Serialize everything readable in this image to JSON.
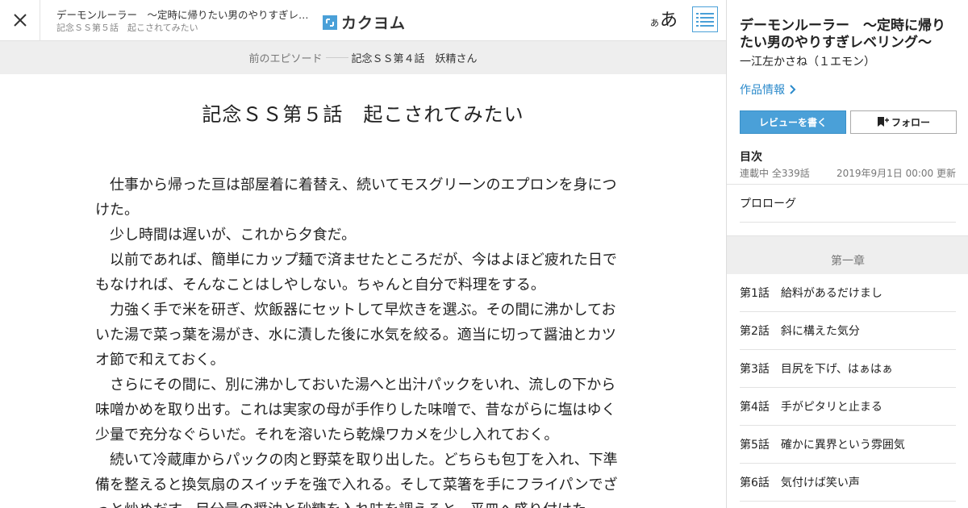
{
  "header": {
    "work_title": "デーモンルーラー　～定時に帰りたい男のやりすぎレベリング～",
    "episode_subtitle": "記念ＳＳ第５話　起こされてみたい",
    "logo_text": "カクヨム",
    "font_small": "あ",
    "font_large": "あ"
  },
  "prev": {
    "label": "前のエピソード",
    "title": "記念ＳＳ第４話　妖精さん"
  },
  "episode": {
    "title": "記念ＳＳ第５話　起こされてみたい",
    "paragraphs": [
      "　仕事から帰った亘は部屋着に着替え、続いてモスグリーンのエプロンを身につけた。",
      "　少し時間は遅いが、これから夕食だ。",
      "　以前であれば、簡単にカップ麺で済ませたところだが、今はよほど疲れた日でもなければ、そんなことはしやしない。ちゃんと自分で料理をする。",
      "　力強く手で米を研ぎ、炊飯器にセットして早炊きを選ぶ。その間に沸かしておいた湯で菜っ葉を湯がき、水に漬した後に水気を絞る。適当に切って醤油とカツオ節で和えておく。",
      "　さらにその間に、別に沸かしておいた湯へと出汁パックをいれ、流しの下から味噌かめを取り出す。これは実家の母が手作りした味噌で、昔ながらに塩はゆく少量で充分なぐらいだ。それを溶いたら乾燥ワカメを少し入れておく。",
      "　続いて冷蔵庫からパックの肉と野菜を取り出した。どちらも包丁を入れ、下準備を整えると換気扇のスイッチを強で入れる。そして菜箸を手にフライパンでざっと炒めだす。目分量の醤油と砂糖を入れ味を調えると、平皿へ盛り付けた。"
    ]
  },
  "sidebar": {
    "title": "デーモンルーラー　～定時に帰りたい男のやりすぎレベリング～",
    "author": "一江左かさね（１エモン）",
    "info_link": "作品情報",
    "review_button": "レビューを書く",
    "follow_button": "フォロー",
    "toc_heading": "目次",
    "status": "連載中 全339話",
    "updated": "2019年9月1日 00:00 更新",
    "prologue": "プロローグ",
    "chapter": "第一章",
    "episodes": [
      "第1話　給料があるだけまし",
      "第2話　斜に構えた気分",
      "第3話　目尻を下げ、はぁはぁ",
      "第4話　手がピタリと止まる",
      "第5話　確かに異界という雰囲気",
      "第6話　気付けば笑い声"
    ]
  },
  "colors": {
    "accent": "#4aa0d8",
    "link": "#2b8acb",
    "bar_bg": "#eeeeee"
  },
  "icons": [
    "close-icon",
    "toc-list-icon",
    "chevron-right-icon",
    "bookmark-plus-icon"
  ]
}
